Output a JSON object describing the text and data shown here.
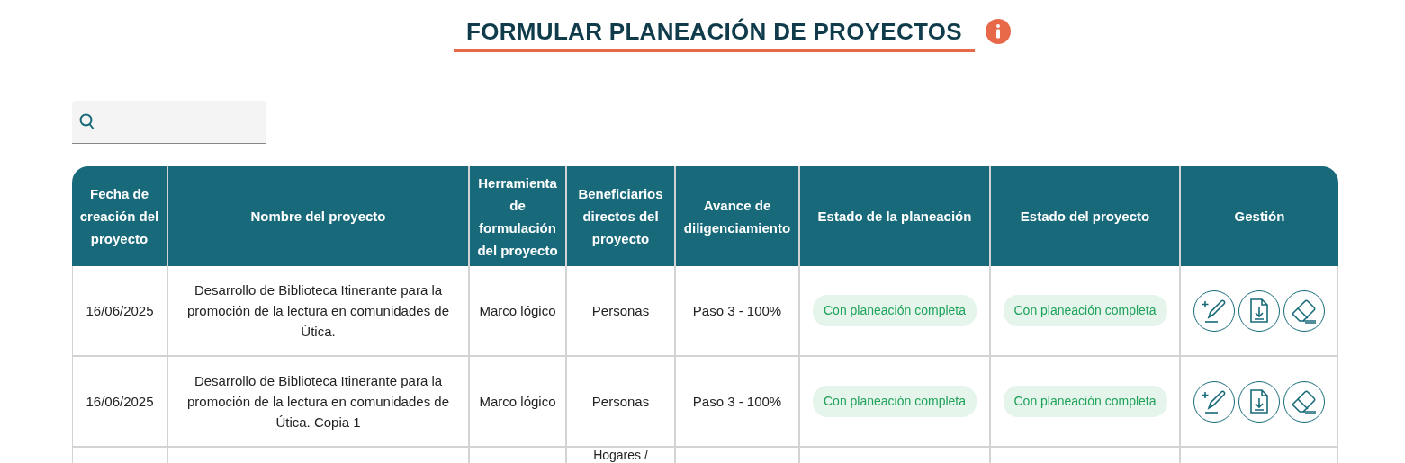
{
  "title": "FORMULAR PLANEACIÓN DE PROYECTOS",
  "table": {
    "columns": [
      "Fecha de creación del proyecto",
      "Nombre del proyecto",
      "Herramienta de formulación del proyecto",
      "Beneficiarios directos del proyecto",
      "Avance de diligenciamiento",
      "Estado de la planeación",
      "Estado del proyecto",
      "Gestión"
    ],
    "rows": [
      {
        "date": "16/06/2025",
        "name": "Desarrollo de Biblioteca Itinerante para la promoción de la lectura en comunidades de Útica.",
        "tool": "Marco lógico",
        "beneficiaries": "Personas",
        "progress": "Paso 3 - 100%",
        "planning_status": "Con planeación completa",
        "project_status": "Con planeación completa"
      },
      {
        "date": "16/06/2025",
        "name": "Desarrollo de Biblioteca Itinerante para la promoción de la lectura en comunidades de Útica. Copia 1",
        "tool": "Marco lógico",
        "beneficiaries": "Personas",
        "progress": "Paso 3 - 100%",
        "planning_status": "Con planeación completa",
        "project_status": "Con planeación completa"
      },
      {
        "beneficiaries": "Hogares /"
      }
    ]
  }
}
